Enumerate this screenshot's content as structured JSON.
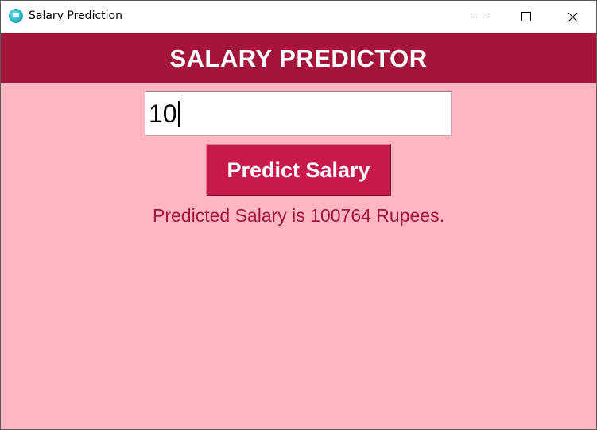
{
  "window": {
    "title": "Salary Prediction",
    "icon": "python-app-icon",
    "controls": {
      "minimize": "minimize-icon",
      "maximize": "maximize-icon",
      "close": "close-icon"
    }
  },
  "header": {
    "title": "SALARY PREDICTOR"
  },
  "input": {
    "value": "10"
  },
  "predict_button": {
    "label": "Predict Salary"
  },
  "result": {
    "text": "Predicted Salary is 100764 Rupees."
  },
  "colors": {
    "background": "#ffb6c1",
    "header": "#a3153b",
    "button": "#c8194d",
    "result_text": "#a3153b"
  }
}
